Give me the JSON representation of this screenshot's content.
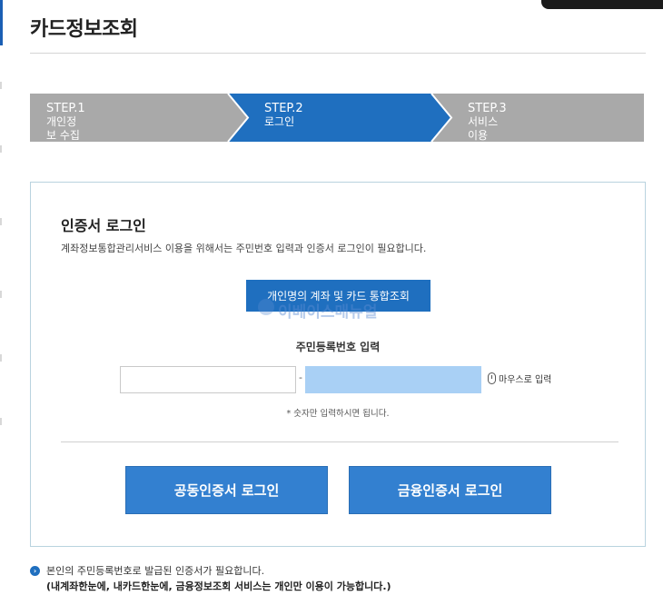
{
  "page": {
    "title": "카드정보조회"
  },
  "steps": [
    {
      "num": "STEP.1",
      "label": "개인정보 수집 및 이용동의",
      "active": false
    },
    {
      "num": "STEP.2",
      "label": "로그인",
      "active": true
    },
    {
      "num": "STEP.3",
      "label": "서비스 이용",
      "active": false
    }
  ],
  "colors": {
    "active_step": "#1f6fbf",
    "inactive_step": "#a9a9a9",
    "primary_button": "#3380d0",
    "rrn_back_field": "#a9d0f5"
  },
  "login": {
    "title": "인증서 로그인",
    "description": "계좌정보통합관리서비스 이용을 위해서는 주민번호 입력과 인증서 로그인이 필요합니다.",
    "tab_label": "개인명의 계좌 및 카드 통합조회",
    "watermark": "이베이스매뉴얼",
    "rrn_label": "주민등록번호 입력",
    "rrn_separator": "-",
    "rrn_front_value": "",
    "rrn_back_value": "",
    "mouse_input_label": "마우스로 입력",
    "hint": "* 숫자만 입력하시면 됩니다.",
    "public_cert_button": "공동인증서 로그인",
    "finance_cert_button": "금융인증서 로그인"
  },
  "notice": {
    "line1": "본인의 주민등록번호로 발급된 인증서가 필요합니다.",
    "line2": "(내계좌한눈에, 내카드한눈에, 금융정보조회 서비스는 개인만 이용이 가능합니다.)"
  }
}
